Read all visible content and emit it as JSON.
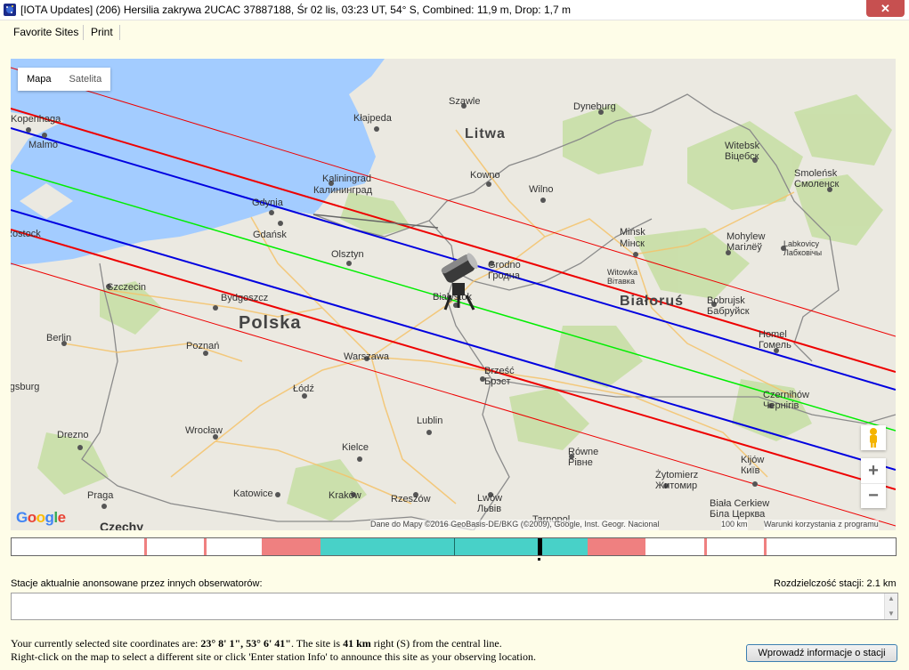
{
  "window": {
    "title": "[IOTA Updates] (206) Hersilia zakrywa 2UCAC 37887188, Śr 02 lis, 03:23 UT, 54° S, Combined: 11,9 m, Drop:  1,7 m",
    "close_label": "✕"
  },
  "menu": {
    "items": [
      {
        "label": "Favorite Sites"
      },
      {
        "label": "Print"
      }
    ]
  },
  "map": {
    "type_buttons": {
      "map": "Mapa",
      "satellite": "Satelita"
    },
    "zoom_in": "+",
    "zoom_out": "−",
    "google_logo": "Google",
    "attribution": "Dane do Mapy ©2016 GeoBasis-DE/BKG (©2009), Google, Inst. Geogr. Nacional",
    "scale_label": "100 km",
    "report_label": "Warunki korzystania z programu",
    "countries": [
      "Litwa",
      "Polska",
      "Białoruś"
    ],
    "cities": [
      "Kopenhaga",
      "Malmo",
      "Kłajpeda",
      "Szawle",
      "Dyneburg",
      "Kowno",
      "Wilno",
      "Kaliningrad",
      "Калининград",
      "Gdynia",
      "Gdańsk",
      "Olsztyn",
      "Grodno",
      "Гродна",
      "Białystok",
      "Mińsk",
      "Мінск",
      "Witebsk",
      "Віцебск",
      "Smoleńsk",
      "Смоленск",
      "Mohylew",
      "Магілёў",
      "Witowka",
      "Вітавка",
      "Bobrujsk",
      "Бабруйск",
      "Homel",
      "Гомель",
      "Szczecin",
      "Bydgoszcz",
      "Berlin",
      "Poznań",
      "Warszawa",
      "Łódź",
      "Brześć",
      "Брэст",
      "Lublin",
      "Czernihów",
      "Чернігів",
      "Wrocław",
      "Drezno",
      "Kielce",
      "Równe",
      "Рівне",
      "Żytomierz",
      "Житомир",
      "Kijów",
      "Київ",
      "Katowice",
      "Kraków",
      "Rzeszów",
      "Lwów",
      "Львів",
      "Praga",
      "Biała Cerkiew",
      "Біла Церква",
      "Tarnopol",
      "Ludwigsburg",
      "Rostock",
      "Labkovicy",
      "Лабковічы",
      "Czechy"
    ],
    "paths": {
      "central_color": "#00ee00",
      "path_edge_color": "#0000e0",
      "sigma_color": "#ee0000",
      "outer_color": "#ee0000"
    },
    "observer_icon": "telescope-icon"
  },
  "timeline": {
    "colors": {
      "inner": "#48d1c8",
      "outer": "#ef8080",
      "marker": "#000000",
      "ticks": "#ef8080"
    }
  },
  "stations": {
    "label": "Stacje aktualnie anonsowane przez innych obserwatorów:",
    "resolution": "Rozdzielczość stacji: 2.1 km",
    "value": ""
  },
  "info": {
    "line1_prefix": "Your currently selected site coordinates are: ",
    "coords": "23° 8' 1\", 53° 6' 41\"",
    "line1_mid": ". The site is ",
    "distance": "41 km",
    "line1_suffix": " right (S) from the central line.",
    "line2": "Right-click on the map to select a different site or click 'Enter station Info' to announce this site as your observing location."
  },
  "buttons": {
    "enter_info": "Wprowadź informacje o stacji"
  }
}
